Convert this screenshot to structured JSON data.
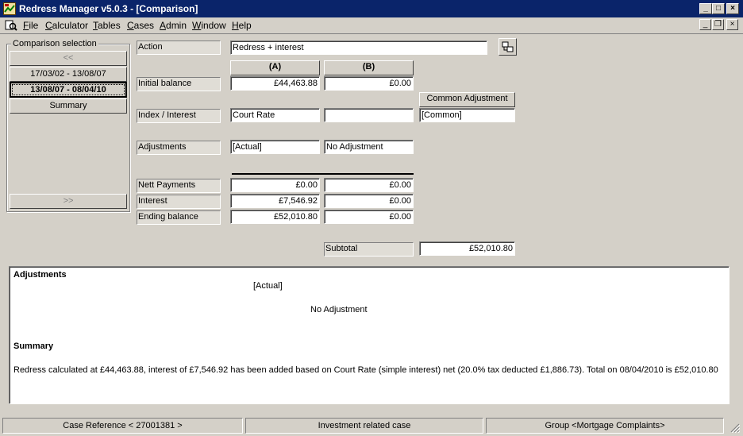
{
  "window": {
    "title": "Redress Manager v5.0.3 - [Comparison]"
  },
  "menu": [
    "File",
    "Calculator",
    "Tables",
    "Cases",
    "Admin",
    "Window",
    "Help"
  ],
  "selection": {
    "title": "Comparison selection",
    "prev_label": "<<",
    "next_label": ">>",
    "periods": [
      "17/03/02 - 13/08/07",
      "13/08/07 - 08/04/10"
    ],
    "summary_label": "Summary"
  },
  "form": {
    "action_label": "Action",
    "action_value": "Redress + interest",
    "col_a": "(A)",
    "col_b": "(B)",
    "common_adjustment": "Common Adjustment",
    "initial_balance_label": "Initial balance",
    "initial_a": "£44,463.88",
    "initial_b": "£0.00",
    "index_label": "Index / Interest",
    "index_a": "Court Rate",
    "index_b": "",
    "index_common": "[Common]",
    "adjustments_label": "Adjustments",
    "adj_a": "[Actual]",
    "adj_b": "No Adjustment",
    "nett_label": "Nett Payments",
    "nett_a": "£0.00",
    "nett_b": "£0.00",
    "interest_label": "Interest",
    "interest_a": "£7,546.92",
    "interest_b": "£0.00",
    "ending_label": "Ending balance",
    "ending_a": "£52,010.80",
    "ending_b": "£0.00",
    "subtotal_label": "Subtotal",
    "subtotal_value": "£52,010.80"
  },
  "details": {
    "adjustments_heading": "Adjustments",
    "adj_a": "[Actual]",
    "adj_b": "No Adjustment",
    "summary_heading": "Summary",
    "summary_text": "Redress calculated at £44,463.88, interest of £7,546.92 has been added based on Court Rate (simple interest) net (20.0% tax deducted £1,886.73). Total on 08/04/2010 is £52,010.80"
  },
  "status": {
    "case_ref": "Case Reference < 27001381 >",
    "type": "Investment related case",
    "group": "Group <Mortgage Complaints>"
  }
}
